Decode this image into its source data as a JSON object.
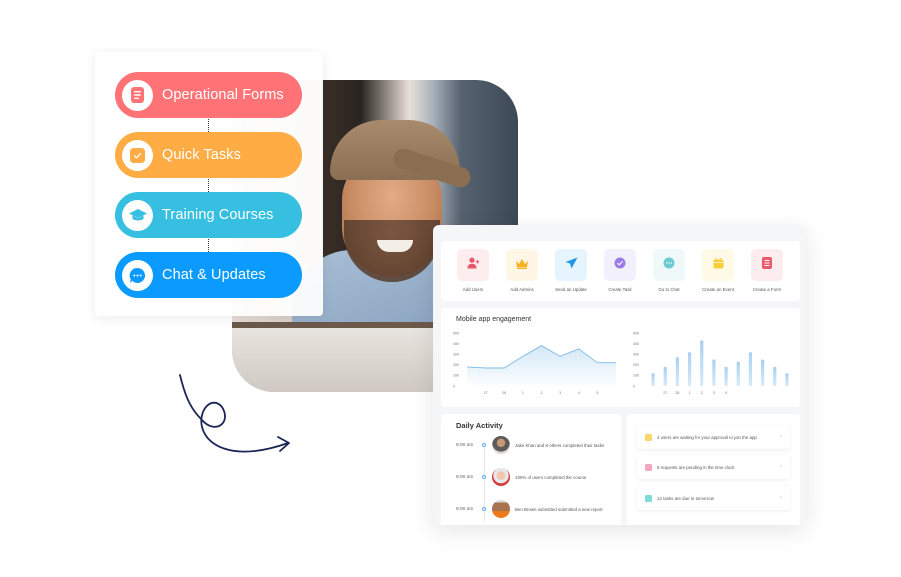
{
  "menu": {
    "items": [
      {
        "label": "Operational Forms",
        "icon": "form-icon",
        "color": "#FF7377"
      },
      {
        "label": "Quick Tasks",
        "icon": "task-check-icon",
        "color": "#FFAC45"
      },
      {
        "label": "Training Courses",
        "icon": "graduation-cap-icon",
        "color": "#36BFE1"
      },
      {
        "label": "Chat & Updates",
        "icon": "chat-bubble-icon",
        "color": "#0B9BFF"
      }
    ]
  },
  "dashboard": {
    "quick_actions": [
      {
        "label": "Add Users",
        "icon": "add-user-icon",
        "bg": "#FDEDEF",
        "fg": "#E8566A"
      },
      {
        "label": "Add Admins",
        "icon": "crown-icon",
        "bg": "#FFF6E5",
        "fg": "#F5B321"
      },
      {
        "label": "Send an Update",
        "icon": "send-icon",
        "bg": "#E6F4FD",
        "fg": "#1E96E6"
      },
      {
        "label": "Create Task",
        "icon": "check-circle-icon",
        "bg": "#F2F0FD",
        "fg": "#9B7BE8"
      },
      {
        "label": "Go to Chat",
        "icon": "chat-icon",
        "bg": "#EFF9FA",
        "fg": "#6CCBD3"
      },
      {
        "label": "Create an Event",
        "icon": "calendar-icon",
        "bg": "#FFFAE6",
        "fg": "#F7CD3B"
      },
      {
        "label": "Create a Form",
        "icon": "form-icon",
        "bg": "#FDECEE",
        "fg": "#E85A69"
      }
    ],
    "engagement_title": "Mobile app engagement",
    "daily_activity": {
      "title": "Daily Activity",
      "items": [
        {
          "time": "8:00 am",
          "text": "Jake Khan and 8 others completed their tasks",
          "avatar": "avatar-jake"
        },
        {
          "time": "8:00 am",
          "text": "100% of users completed the course",
          "avatar": "avatar-course"
        },
        {
          "time": "8:00 am",
          "text": "Ben Brown submitted submitted a new report",
          "avatar": "avatar-ben"
        }
      ]
    },
    "notifications": [
      {
        "text": "4 users are waiting for your approval to join the app",
        "color": "#FAD66B",
        "icon": "user-wait-icon"
      },
      {
        "text": "6 requests are pending in the time clock",
        "color": "#F4A6C0",
        "icon": "clock-icon"
      },
      {
        "text": "12 tasks are due to tomorrow",
        "color": "#7FDBD8",
        "icon": "task-icon"
      }
    ]
  },
  "chart_data": [
    {
      "type": "area",
      "title": "Mobile app engagement",
      "x": [
        "",
        "27",
        "28",
        "1",
        "2",
        "3",
        "4",
        "5",
        ""
      ],
      "yticks": [
        "0",
        "100",
        "200",
        "300",
        "400",
        "500"
      ],
      "ylim": [
        0,
        500
      ],
      "values": [
        180,
        170,
        170,
        280,
        380,
        280,
        350,
        220,
        220
      ],
      "color": "#7FBCE8"
    },
    {
      "type": "bar",
      "categories": [
        "",
        "27",
        "28",
        "1",
        "2",
        "3",
        "4",
        "",
        "",
        "",
        "",
        ""
      ],
      "yticks": [
        "0",
        "100",
        "200",
        "300",
        "400",
        "500"
      ],
      "ylim": [
        0,
        500
      ],
      "values": [
        120,
        180,
        270,
        320,
        430,
        250,
        180,
        230,
        320,
        250,
        180,
        120
      ],
      "color": "#A8D0F2"
    }
  ]
}
